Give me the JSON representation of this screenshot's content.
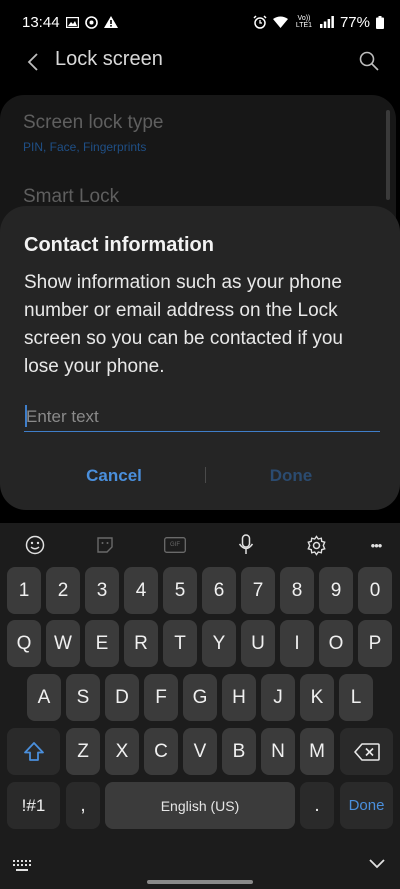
{
  "status_bar": {
    "time": "13:44",
    "battery": "77%",
    "network": "Vo)) LTE1"
  },
  "header": {
    "title": "Lock screen"
  },
  "settings": {
    "items": [
      {
        "title": "Screen lock type",
        "subtitle": "PIN, Face, Fingerprints"
      },
      {
        "title": "Smart Lock",
        "subtitle": ""
      }
    ]
  },
  "dialog": {
    "title": "Contact information",
    "body": "Show information such as your phone number or email address on the Lock screen so you can be contacted if you lose your phone.",
    "input_placeholder": "Enter text",
    "input_value": "",
    "cancel_label": "Cancel",
    "done_label": "Done"
  },
  "keyboard": {
    "toolbar": [
      "emoji-icon",
      "sticker-icon",
      "gif-icon",
      "microphone-icon",
      "settings-icon",
      "more-icon"
    ],
    "gif_label": "GIF",
    "more_label": "•••",
    "row_numbers": [
      "1",
      "2",
      "3",
      "4",
      "5",
      "6",
      "7",
      "8",
      "9",
      "0"
    ],
    "row_1": [
      "Q",
      "W",
      "E",
      "R",
      "T",
      "Y",
      "U",
      "I",
      "O",
      "P"
    ],
    "row_2": [
      "A",
      "S",
      "D",
      "F",
      "G",
      "H",
      "J",
      "K",
      "L"
    ],
    "row_3": [
      "Z",
      "X",
      "C",
      "V",
      "B",
      "N",
      "M"
    ],
    "symbols_label": "!#1",
    "comma_label": ",",
    "space_label": "English (US)",
    "period_label": ".",
    "done_label": "Done"
  },
  "colors": {
    "accent": "#4a8fdc",
    "dialog_bg": "#252525",
    "keyboard_bg": "#1c1c1c",
    "key_bg": "#3b3b3b"
  }
}
